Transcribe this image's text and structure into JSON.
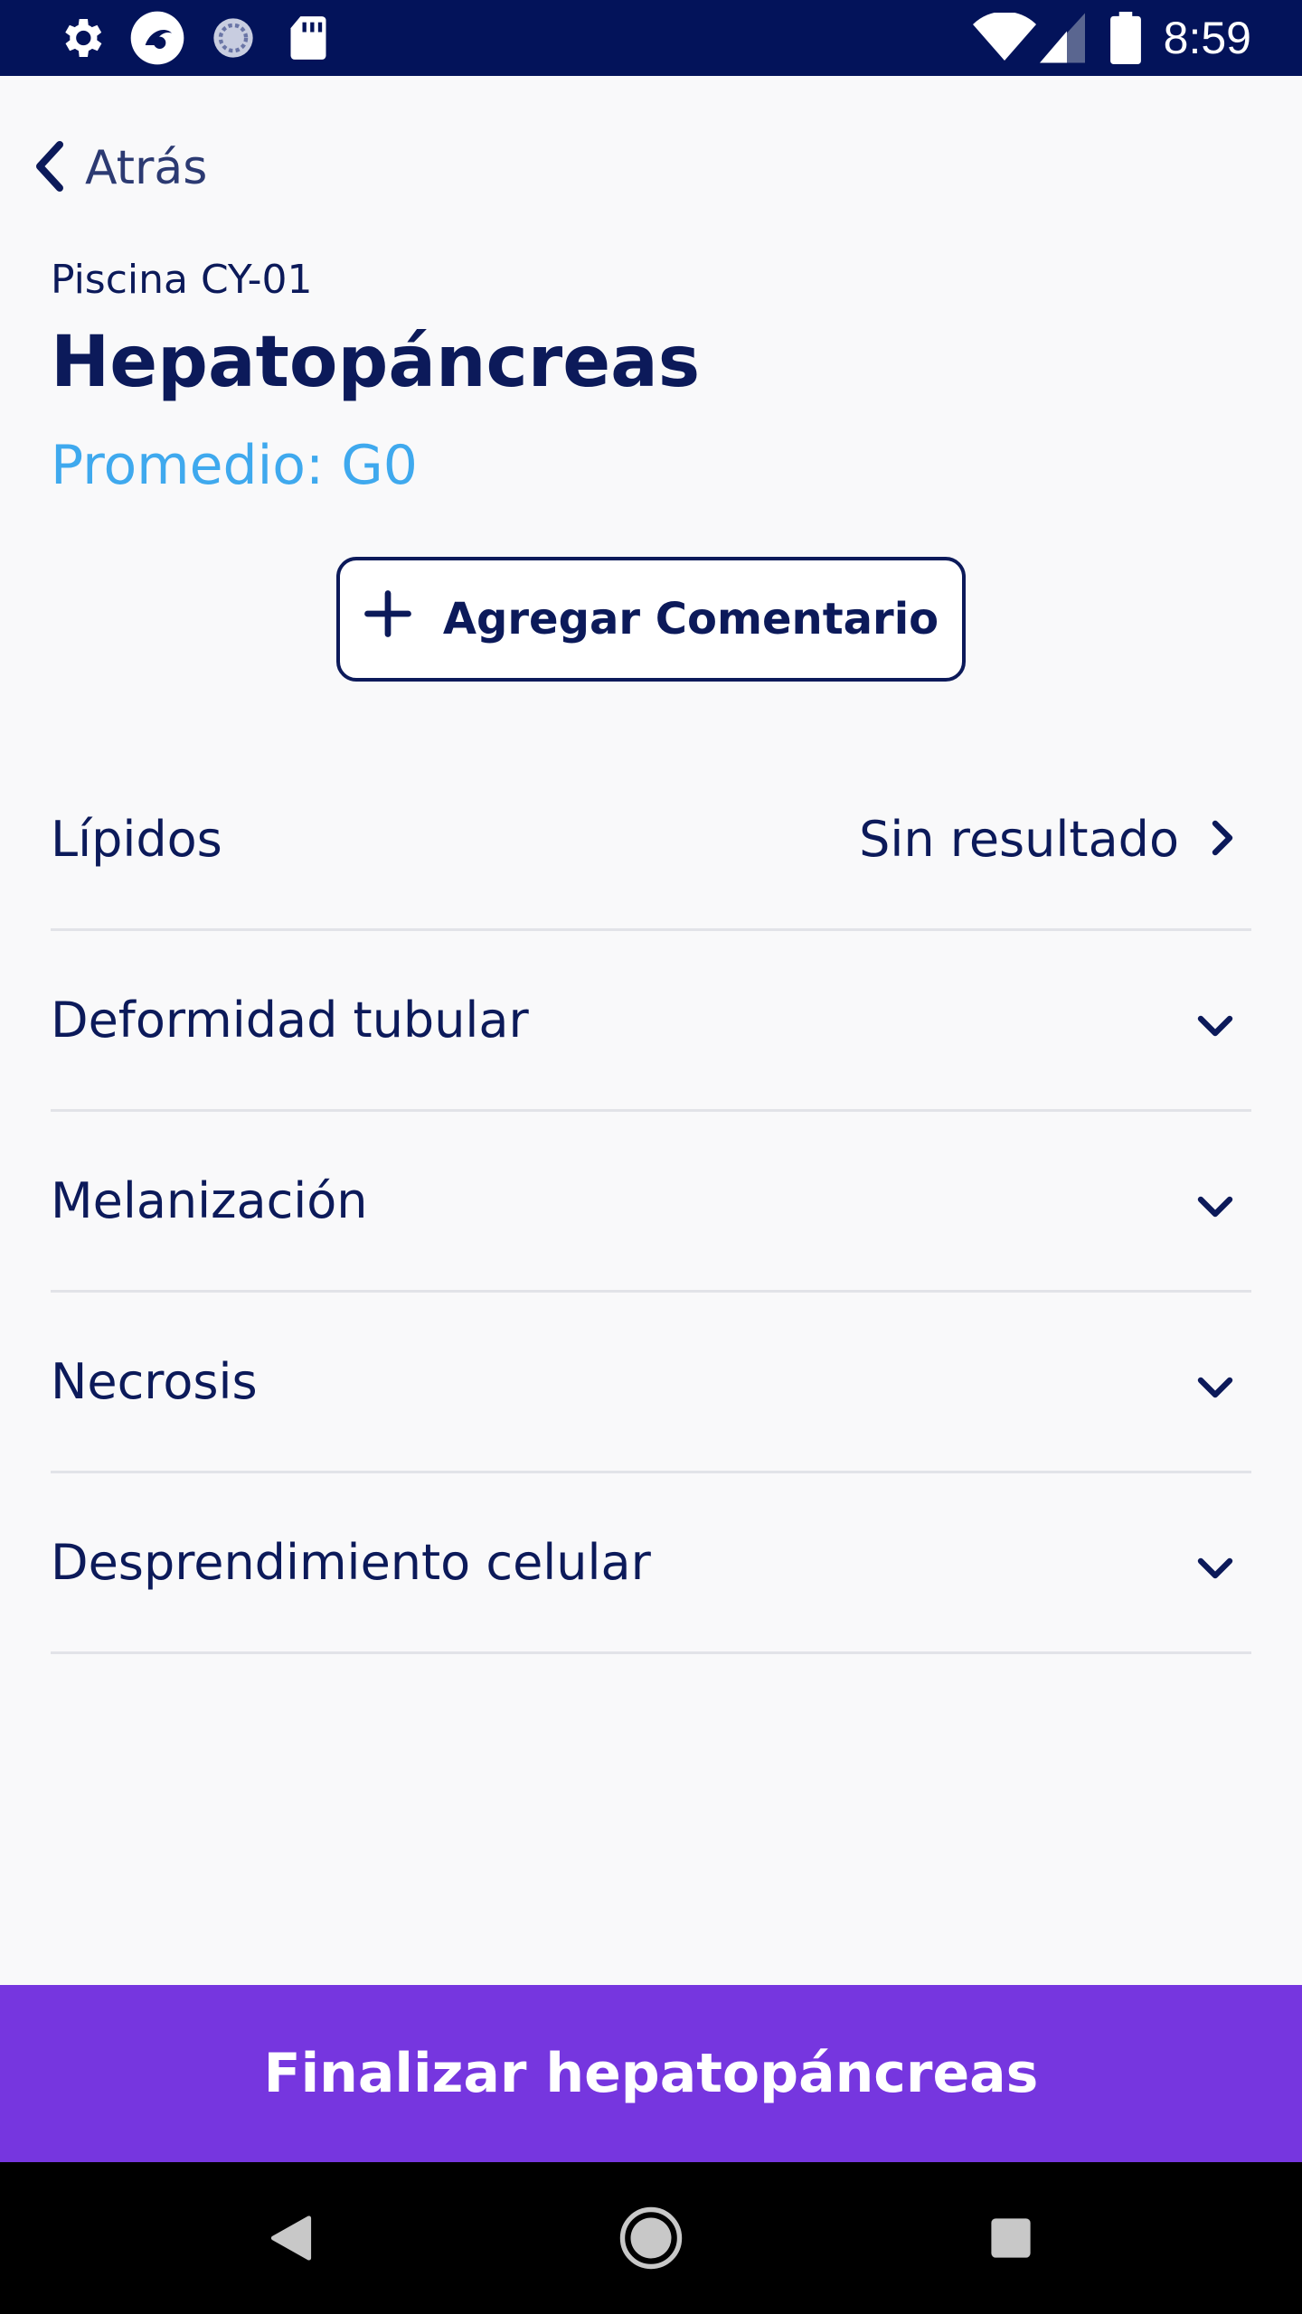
{
  "status_bar": {
    "time": "8:59",
    "left_icons": [
      "gear-icon",
      "app-logo-icon",
      "sync-icon",
      "sd-card-icon"
    ],
    "right_icons": [
      "wifi-icon",
      "signal-icon",
      "battery-icon"
    ]
  },
  "nav": {
    "back_label": "Atrás"
  },
  "header": {
    "pool": "Piscina CY-01",
    "title": "Hepatopáncreas",
    "average": "Promedio: G0"
  },
  "comment_button": {
    "label": "Agregar Comentario"
  },
  "rows": [
    {
      "label": "Lípidos",
      "result": "Sin resultado",
      "icon": "chevron-right-icon"
    },
    {
      "label": "Deformidad tubular",
      "icon": "chevron-down-icon"
    },
    {
      "label": "Melanización",
      "icon": "chevron-down-icon"
    },
    {
      "label": "Necrosis",
      "icon": "chevron-down-icon"
    },
    {
      "label": "Desprendimiento celular",
      "icon": "chevron-down-icon"
    }
  ],
  "finalize_button": {
    "label": "Finalizar hepatopáncreas"
  },
  "system_nav": [
    "back-triangle-icon",
    "home-circle-icon",
    "recents-square-icon"
  ],
  "colors": {
    "status_bar": "#03135a",
    "primary_text": "#0c1a5a",
    "accent_blue": "#3fa9ee",
    "finalize_purple": "#7636df"
  }
}
